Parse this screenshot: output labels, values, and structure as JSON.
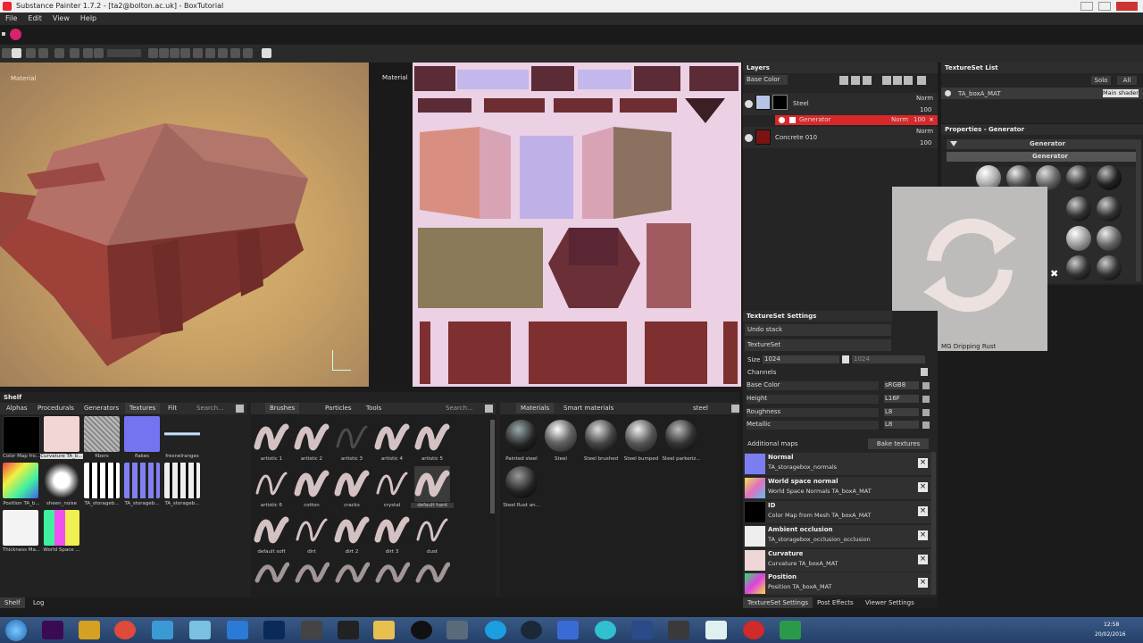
{
  "window": {
    "title": "Substance Painter 1.7.2 - [ta2@bolton.ac.uk] - BoxTutorial"
  },
  "menu": [
    "File",
    "Edit",
    "View",
    "Help"
  ],
  "viewport3d": {
    "label": "Material"
  },
  "viewport2d": {
    "label": "Material"
  },
  "layers": {
    "title": "Layers",
    "channel_select": "Base Color",
    "items": [
      {
        "name": "Steel",
        "blend": "Norm",
        "opacity": "100"
      },
      {
        "name": "Generator",
        "blend": "Norm",
        "opacity": "100"
      },
      {
        "name": "Concrete 010",
        "blend": "Norm",
        "opacity": "100"
      }
    ]
  },
  "textureset_list": {
    "title": "TextureSet List",
    "solo": "Solo",
    "all": "All",
    "item": "TA_boxA_MAT",
    "shader": "Main shader"
  },
  "properties": {
    "title": "Properties - Generator",
    "section": "Generator",
    "subsection": "Generator"
  },
  "loading_overlay": {
    "label": "MG Dripping Rust"
  },
  "textureset_settings": {
    "title": "TextureSet Settings",
    "undo_stack": "Undo stack",
    "textureset": "TextureSet",
    "size_label": "Size",
    "size_value": "1024",
    "size_value2": "1024",
    "channels_label": "Channels",
    "channels": [
      {
        "name": "Base Color",
        "format": "sRGB8"
      },
      {
        "name": "Height",
        "format": "L16F"
      },
      {
        "name": "Roughness",
        "format": "L8"
      },
      {
        "name": "Metallic",
        "format": "L8"
      }
    ],
    "additional_maps": "Additional maps",
    "bake_button": "Bake textures",
    "maps": [
      {
        "name": "Normal",
        "value": "TA_storagebox_normals"
      },
      {
        "name": "World space normal",
        "value": "World Space Normals TA_boxA_MAT"
      },
      {
        "name": "ID",
        "value": "Color Map from Mesh TA_boxA_MAT"
      },
      {
        "name": "Ambient occlusion",
        "value": "TA_storagebox_occlusion_occlusion"
      },
      {
        "name": "Curvature",
        "value": "Curvature TA_boxA_MAT"
      },
      {
        "name": "Position",
        "value": "Position TA_boxA_MAT"
      }
    ],
    "bottom_tabs": [
      "TextureSet Settings",
      "Post Effects",
      "Viewer Settings"
    ]
  },
  "shelf": {
    "title": "Shelf",
    "tabs": [
      "Alphas",
      "Procedurals",
      "Generators",
      "Textures",
      "Filt"
    ],
    "search": "Search...",
    "textures": [
      "Color Map fro...",
      "Curvature TA_b...",
      "fibers",
      "flakes",
      "fresnelranges",
      "Position TA_b...",
      "sheen_noise",
      "TA_storageb...",
      "TA_storageb...",
      "TA_storageb...",
      "Thickness Ma...",
      "World Space ..."
    ],
    "brush_tabs": [
      "Brushes",
      "Particles",
      "Tools"
    ],
    "brush_search": "Search...",
    "brushes": [
      "artistic 1",
      "artistic 2",
      "artistic 3",
      "artistic 4",
      "artistic 5",
      "artistic 6",
      "cotton",
      "cracks",
      "crystal",
      "default hard",
      "default soft",
      "dirt",
      "dirt 2",
      "dirt 3",
      "dust"
    ],
    "material_tabs": [
      "Materials",
      "Smart materials"
    ],
    "material_filter": "steel",
    "materials": [
      "Painted steel",
      "Steel",
      "Steel brushed",
      "Steel bumped",
      "Steel parkeriz...",
      "Steel Rust an..."
    ],
    "bottom_tabs": [
      "Shelf",
      "Log"
    ]
  },
  "taskbar": {
    "time": "12:58",
    "date": "20/02/2016"
  },
  "colors": {
    "accent_red": "#d7282a",
    "panel_bg": "#252525",
    "box_red": "#a44a43"
  }
}
